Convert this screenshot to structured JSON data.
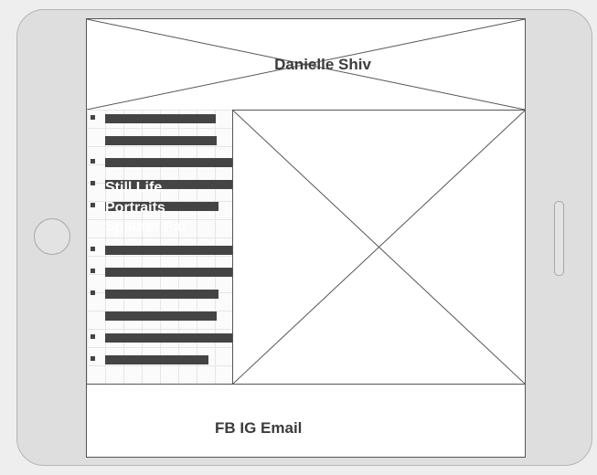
{
  "header": {
    "title": "Danielle Shiv"
  },
  "menu": {
    "labels": [
      "Still Life",
      "Portraits",
      "Splatter Pai"
    ],
    "rows": [
      {
        "bullet": true,
        "bar": 0.75
      },
      {
        "bullet": false,
        "bar": 0.76
      },
      {
        "bullet": true,
        "bar": 0.87
      },
      {
        "bullet": true,
        "bar": 0.87
      },
      {
        "bullet": true,
        "bar": 0.77
      },
      {
        "bullet": false,
        "bar": 0.0
      },
      {
        "bullet": true,
        "bar": 0.87
      },
      {
        "bullet": true,
        "bar": 0.87
      },
      {
        "bullet": true,
        "bar": 0.77
      },
      {
        "bullet": false,
        "bar": 0.76
      },
      {
        "bullet": true,
        "bar": 0.87
      },
      {
        "bullet": true,
        "bar": 0.7
      }
    ]
  },
  "footer": {
    "links_text": "FB IG Email"
  }
}
